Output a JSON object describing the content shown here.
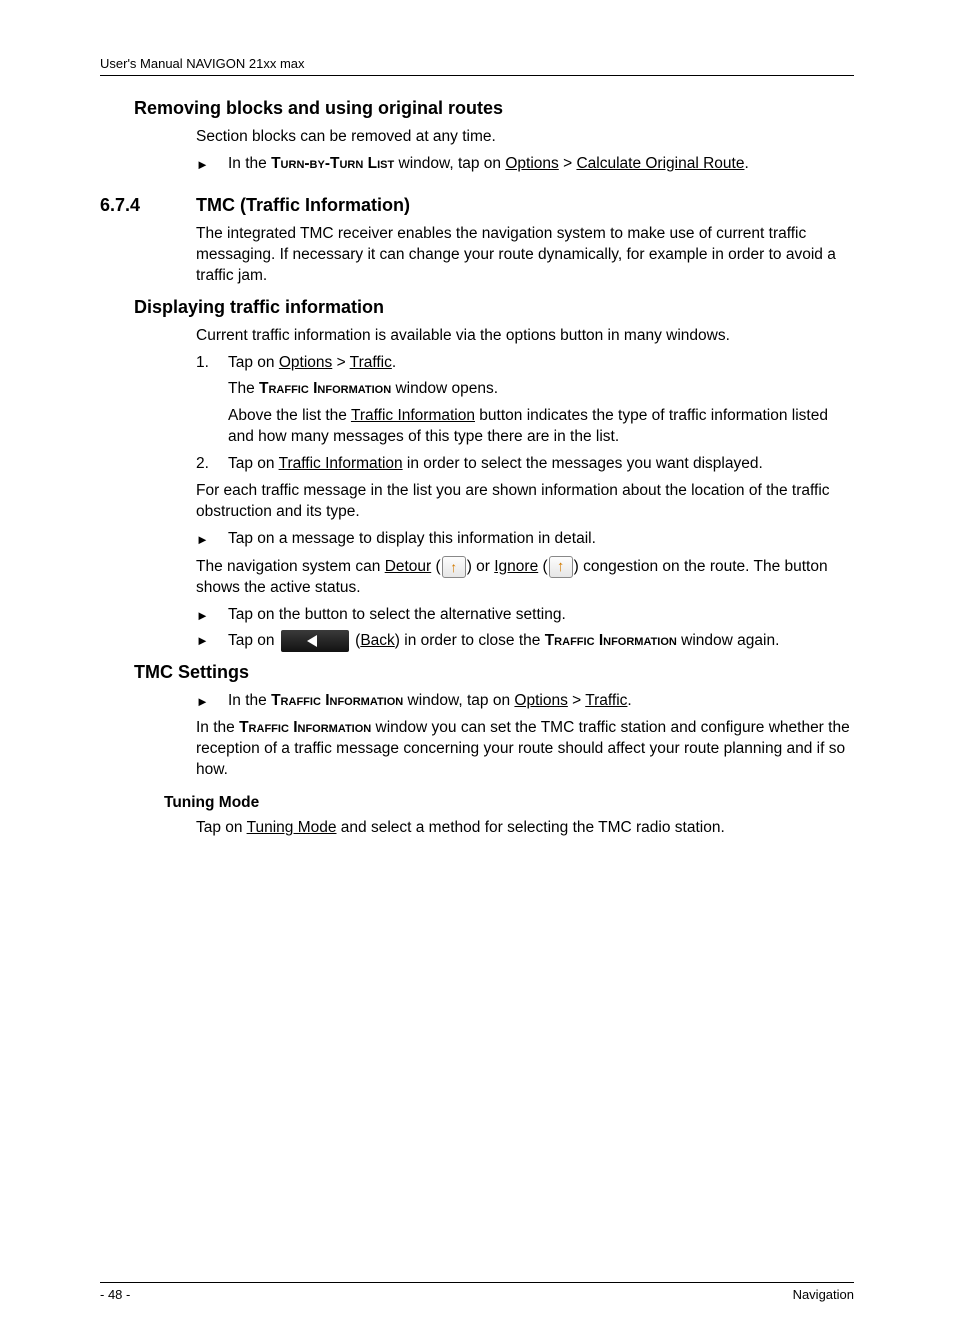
{
  "header": {
    "running": "User's Manual NAVIGON 21xx max"
  },
  "s1": {
    "title": "Removing blocks and using original routes",
    "p1": "Section blocks can be removed at any time.",
    "b1_pre": "In the ",
    "b1_win": "Turn-by-Turn List",
    "b1_mid": " window, tap on ",
    "b1_opt": "Options",
    "b1_gt": " > ",
    "b1_calc": "Calculate Original Route",
    "b1_dot": "."
  },
  "s2": {
    "num": "6.7.4",
    "title": "TMC (Traffic Information)",
    "p1": "The integrated TMC receiver enables the navigation system to make use of current traffic messaging. If necessary it can change your route dynamically, for example in order to avoid a traffic jam."
  },
  "s3": {
    "title": "Displaying traffic information",
    "p1": "Current traffic information is available via the options button in many windows.",
    "n1_pre": "Tap on ",
    "n1_opt": "Options",
    "n1_gt": " > ",
    "n1_tr": "Traffic",
    "n1_dot": ".",
    "p2_pre": "The ",
    "p2_win": "Traffic Information",
    "p2_post": " window opens.",
    "p3_pre": "Above the list the ",
    "p3_btn": "Traffic Information",
    "p3_post": " button indicates the type of traffic information listed and how many messages of this type there are in the list.",
    "n2_pre": "Tap on ",
    "n2_btn": "Traffic Information",
    "n2_post": " in order to select the messages you want displayed.",
    "p4": "For each traffic message in the list you are shown information about the location of the traffic obstruction and its type.",
    "b1": "Tap on a message to display this information in detail.",
    "p5_pre": "The navigation system can ",
    "p5_detour": "Detour",
    "p5_mid1": " (",
    "p5_mid2": ") or ",
    "p5_ignore": "Ignore",
    "p5_mid3": " (",
    "p5_post": ") congestion on the route. The button shows the active status.",
    "b2": "Tap on the button to select the alternative setting.",
    "b3_pre": "Tap on ",
    "b3_mid": " (",
    "b3_back": "Back",
    "b3_mid2": ") in order to close the ",
    "b3_win": "Traffic Information",
    "b3_post": " window again."
  },
  "s4": {
    "title": "TMC Settings",
    "b1_pre": "In the ",
    "b1_win": "Traffic Information",
    "b1_mid": " window, tap on ",
    "b1_opt": "Options",
    "b1_gt": " > ",
    "b1_tr": "Traffic",
    "b1_dot": ".",
    "p1_pre": "In the ",
    "p1_win": "Traffic Information",
    "p1_post": " window you can set the TMC traffic station and configure whether the reception of a traffic message concerning your route should affect your route planning and if so how."
  },
  "s5": {
    "title": "Tuning Mode",
    "p1_pre": "Tap on ",
    "p1_btn": "Tuning Mode",
    "p1_post": " and select a method for selecting the TMC radio station."
  },
  "footer": {
    "page": "- 48 -",
    "section": "Navigation"
  },
  "markers": {
    "arrow": "►",
    "num1": "1.",
    "num2": "2."
  }
}
